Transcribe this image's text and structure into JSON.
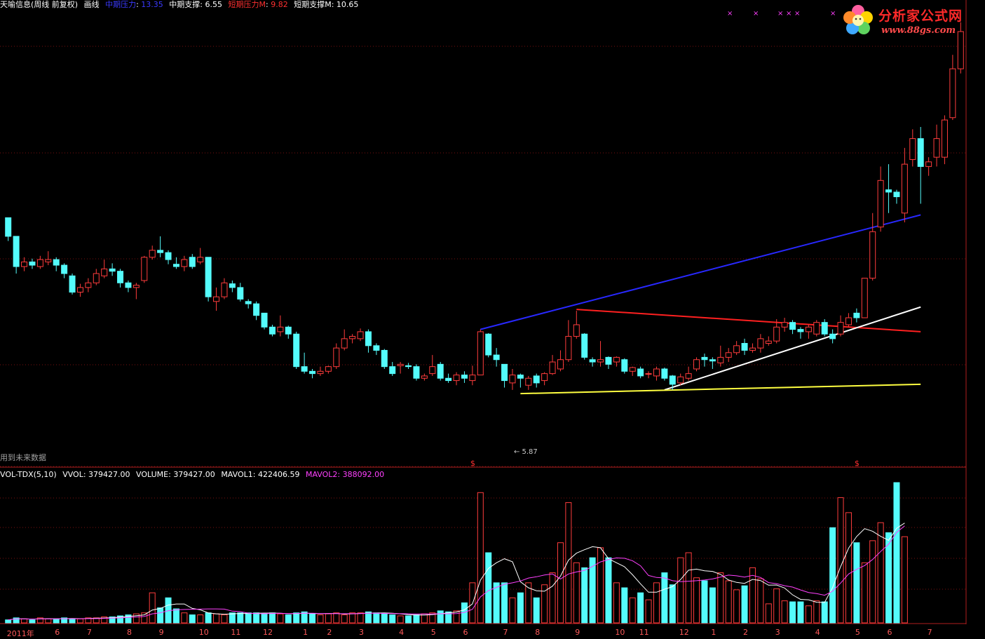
{
  "header": {
    "title": "天喻信息(周线 前复权)",
    "mode": "画线",
    "items": [
      {
        "label": "中期压力",
        "value": "13.35",
        "color": "#3a3aff"
      },
      {
        "label": "中期支撑",
        "value": "6.55",
        "color": "#ffffff"
      },
      {
        "label": "短期压力M",
        "value": "9.82",
        "color": "#ff3030"
      },
      {
        "label": "短期支撑M",
        "value": "10.65",
        "color": "#ffffff"
      }
    ]
  },
  "logo": {
    "title": "分析家公式网",
    "url": "www.88gs.com"
  },
  "future_note": "用到未来数据",
  "min_marker": "← 5.87",
  "signal_marker": "$",
  "volume_header": {
    "name": "VOL-TDX(5,10)",
    "items": [
      {
        "label": "VVOL",
        "value": "379427.00",
        "color": "#ffffff"
      },
      {
        "label": "VOLUME",
        "value": "379427.00",
        "color": "#ffffff"
      },
      {
        "label": "MAVOL1",
        "value": "422406.59",
        "color": "#ffffff"
      },
      {
        "label": "MAVOL2",
        "value": "388092.00",
        "color": "#ff40ff"
      }
    ]
  },
  "colors": {
    "up": "#ff3c3c",
    "down": "#54fcfc",
    "axis": "#b01e1e",
    "grid": "#7a1010"
  },
  "chart_data": {
    "type": "candlestick",
    "x_labels": [
      "2011年",
      "6",
      "7",
      "8",
      "9",
      "10",
      "11",
      "12",
      "1",
      "2",
      "3",
      "4",
      "5",
      "6",
      "7",
      "8",
      "9",
      "10",
      "11",
      "12",
      "1",
      "2",
      "3",
      "4",
      "5",
      "6",
      "7"
    ],
    "x_label_index": [
      0,
      6,
      10,
      15,
      19,
      24,
      28,
      32,
      37,
      40,
      44,
      49,
      53,
      57,
      62,
      66,
      71,
      76,
      79,
      84,
      88,
      92,
      96,
      101,
      106,
      110,
      115
    ],
    "price_range": [
      5.5,
      14.8
    ],
    "volume_range": [
      0,
      1400000
    ],
    "candles": [
      {
        "o": 10.8,
        "c": 10.4,
        "h": 10.8,
        "l": 10.3
      },
      {
        "o": 10.4,
        "c": 9.75,
        "h": 10.4,
        "l": 9.6
      },
      {
        "o": 9.75,
        "c": 9.85,
        "h": 9.95,
        "l": 9.65
      },
      {
        "o": 9.85,
        "c": 9.78,
        "h": 9.92,
        "l": 9.7
      },
      {
        "o": 9.75,
        "c": 9.9,
        "h": 9.98,
        "l": 9.7
      },
      {
        "o": 9.85,
        "c": 9.9,
        "h": 10.08,
        "l": 9.78
      },
      {
        "o": 9.9,
        "c": 9.78,
        "h": 9.95,
        "l": 9.65
      },
      {
        "o": 9.78,
        "c": 9.6,
        "h": 9.82,
        "l": 9.5
      },
      {
        "o": 9.55,
        "c": 9.2,
        "h": 9.6,
        "l": 9.15
      },
      {
        "o": 9.2,
        "c": 9.3,
        "h": 9.38,
        "l": 9.1
      },
      {
        "o": 9.3,
        "c": 9.4,
        "h": 9.5,
        "l": 9.2
      },
      {
        "o": 9.4,
        "c": 9.6,
        "h": 9.7,
        "l": 9.35
      },
      {
        "o": 9.55,
        "c": 9.7,
        "h": 9.9,
        "l": 9.5
      },
      {
        "o": 9.7,
        "c": 9.65,
        "h": 9.82,
        "l": 9.55
      },
      {
        "o": 9.65,
        "c": 9.4,
        "h": 9.7,
        "l": 9.3
      },
      {
        "o": 9.4,
        "c": 9.3,
        "h": 9.45,
        "l": 9.2
      },
      {
        "o": 9.3,
        "c": 9.35,
        "h": 9.4,
        "l": 9.05
      },
      {
        "o": 9.45,
        "c": 9.95,
        "h": 9.98,
        "l": 9.4
      },
      {
        "o": 9.95,
        "c": 10.1,
        "h": 10.2,
        "l": 9.9
      },
      {
        "o": 10.1,
        "c": 10.05,
        "h": 10.4,
        "l": 9.95
      },
      {
        "o": 10.05,
        "c": 9.9,
        "h": 10.1,
        "l": 9.8
      },
      {
        "o": 9.8,
        "c": 9.75,
        "h": 9.95,
        "l": 9.7
      },
      {
        "o": 9.75,
        "c": 9.9,
        "h": 9.98,
        "l": 9.65
      },
      {
        "o": 9.95,
        "c": 9.75,
        "h": 10.02,
        "l": 9.7
      },
      {
        "o": 9.85,
        "c": 9.95,
        "h": 10.15,
        "l": 9.8
      },
      {
        "o": 9.95,
        "c": 9.1,
        "h": 9.95,
        "l": 9.0
      },
      {
        "o": 9.0,
        "c": 9.1,
        "h": 9.3,
        "l": 8.8
      },
      {
        "o": 9.1,
        "c": 9.4,
        "h": 9.5,
        "l": 9.05
      },
      {
        "o": 9.38,
        "c": 9.3,
        "h": 9.45,
        "l": 9.2
      },
      {
        "o": 9.3,
        "c": 9.05,
        "h": 9.4,
        "l": 9.0
      },
      {
        "o": 9.0,
        "c": 8.95,
        "h": 9.05,
        "l": 8.85
      },
      {
        "o": 8.95,
        "c": 8.7,
        "h": 9.0,
        "l": 8.6
      },
      {
        "o": 8.75,
        "c": 8.45,
        "h": 8.75,
        "l": 8.4
      },
      {
        "o": 8.45,
        "c": 8.3,
        "h": 8.5,
        "l": 8.25
      },
      {
        "o": 8.35,
        "c": 8.45,
        "h": 8.7,
        "l": 8.25
      },
      {
        "o": 8.45,
        "c": 8.3,
        "h": 8.48,
        "l": 8.2
      },
      {
        "o": 8.3,
        "c": 7.6,
        "h": 8.35,
        "l": 7.55
      },
      {
        "o": 7.6,
        "c": 7.5,
        "h": 7.9,
        "l": 7.45
      },
      {
        "o": 7.5,
        "c": 7.45,
        "h": 7.55,
        "l": 7.35
      },
      {
        "o": 7.45,
        "c": 7.5,
        "h": 7.6,
        "l": 7.4
      },
      {
        "o": 7.5,
        "c": 7.6,
        "h": 7.62,
        "l": 7.45
      },
      {
        "o": 7.6,
        "c": 8.0,
        "h": 8.1,
        "l": 7.55
      },
      {
        "o": 8.0,
        "c": 8.2,
        "h": 8.4,
        "l": 7.95
      },
      {
        "o": 8.2,
        "c": 8.25,
        "h": 8.3,
        "l": 8.1
      },
      {
        "o": 8.2,
        "c": 8.35,
        "h": 8.42,
        "l": 8.15
      },
      {
        "o": 8.35,
        "c": 8.05,
        "h": 8.4,
        "l": 7.9
      },
      {
        "o": 8.05,
        "c": 7.95,
        "h": 8.1,
        "l": 7.85
      },
      {
        "o": 7.95,
        "c": 7.6,
        "h": 7.98,
        "l": 7.55
      },
      {
        "o": 7.6,
        "c": 7.45,
        "h": 7.7,
        "l": 7.4
      },
      {
        "o": 7.62,
        "c": 7.65,
        "h": 7.7,
        "l": 7.45
      },
      {
        "o": 7.62,
        "c": 7.6,
        "h": 7.68,
        "l": 7.55
      },
      {
        "o": 7.6,
        "c": 7.35,
        "h": 7.65,
        "l": 7.3
      },
      {
        "o": 7.35,
        "c": 7.4,
        "h": 7.45,
        "l": 7.3
      },
      {
        "o": 7.45,
        "c": 7.6,
        "h": 7.85,
        "l": 7.4
      },
      {
        "o": 7.65,
        "c": 7.35,
        "h": 7.7,
        "l": 7.3
      },
      {
        "o": 7.35,
        "c": 7.3,
        "h": 7.45,
        "l": 7.25
      },
      {
        "o": 7.3,
        "c": 7.42,
        "h": 7.48,
        "l": 7.2
      },
      {
        "o": 7.42,
        "c": 7.35,
        "h": 7.5,
        "l": 7.25
      },
      {
        "o": 7.3,
        "c": 7.42,
        "h": 7.62,
        "l": 7.2
      },
      {
        "o": 7.42,
        "c": 8.35,
        "h": 8.4,
        "l": 7.42
      },
      {
        "o": 8.3,
        "c": 7.85,
        "h": 8.32,
        "l": 7.8
      },
      {
        "o": 7.85,
        "c": 7.75,
        "h": 8.0,
        "l": 7.6
      },
      {
        "o": 7.65,
        "c": 7.3,
        "h": 7.65,
        "l": 7.15
      },
      {
        "o": 7.25,
        "c": 7.42,
        "h": 7.55,
        "l": 7.1
      },
      {
        "o": 7.42,
        "c": 7.35,
        "h": 7.45,
        "l": 7.15
      },
      {
        "o": 7.2,
        "c": 7.35,
        "h": 7.4,
        "l": 7.1
      },
      {
        "o": 7.4,
        "c": 7.25,
        "h": 7.45,
        "l": 7.15
      },
      {
        "o": 7.3,
        "c": 7.45,
        "h": 7.48,
        "l": 7.2
      },
      {
        "o": 7.45,
        "c": 7.7,
        "h": 7.85,
        "l": 7.42
      },
      {
        "o": 7.55,
        "c": 7.75,
        "h": 7.95,
        "l": 7.5
      },
      {
        "o": 7.75,
        "c": 8.25,
        "h": 8.6,
        "l": 7.7
      },
      {
        "o": 8.25,
        "c": 8.5,
        "h": 8.8,
        "l": 8.2
      },
      {
        "o": 8.3,
        "c": 7.8,
        "h": 8.32,
        "l": 7.75
      },
      {
        "o": 7.75,
        "c": 7.7,
        "h": 7.8,
        "l": 7.6
      },
      {
        "o": 7.7,
        "c": 7.75,
        "h": 8.15,
        "l": 7.6
      },
      {
        "o": 7.8,
        "c": 7.65,
        "h": 7.82,
        "l": 7.55
      },
      {
        "o": 7.7,
        "c": 7.8,
        "h": 7.82,
        "l": 7.6
      },
      {
        "o": 7.75,
        "c": 7.5,
        "h": 7.78,
        "l": 7.45
      },
      {
        "o": 7.5,
        "c": 7.58,
        "h": 7.6,
        "l": 7.4
      },
      {
        "o": 7.55,
        "c": 7.4,
        "h": 7.6,
        "l": 7.35
      },
      {
        "o": 7.45,
        "c": 7.45,
        "h": 7.5,
        "l": 7.35
      },
      {
        "o": 7.4,
        "c": 7.55,
        "h": 7.6,
        "l": 7.3
      },
      {
        "o": 7.55,
        "c": 7.35,
        "h": 7.58,
        "l": 7.3
      },
      {
        "o": 7.4,
        "c": 7.22,
        "h": 7.42,
        "l": 7.1
      },
      {
        "o": 7.25,
        "c": 7.38,
        "h": 7.45,
        "l": 7.2
      },
      {
        "o": 7.35,
        "c": 7.45,
        "h": 7.6,
        "l": 7.3
      },
      {
        "o": 7.55,
        "c": 7.75,
        "h": 7.8,
        "l": 7.5
      },
      {
        "o": 7.8,
        "c": 7.75,
        "h": 7.88,
        "l": 7.6
      },
      {
        "o": 7.75,
        "c": 7.72,
        "h": 7.8,
        "l": 7.55
      },
      {
        "o": 7.68,
        "c": 7.8,
        "h": 8.05,
        "l": 7.6
      },
      {
        "o": 7.8,
        "c": 7.9,
        "h": 8.0,
        "l": 7.7
      },
      {
        "o": 7.9,
        "c": 8.05,
        "h": 8.15,
        "l": 7.85
      },
      {
        "o": 8.1,
        "c": 7.95,
        "h": 8.2,
        "l": 7.85
      },
      {
        "o": 7.95,
        "c": 8.0,
        "h": 8.1,
        "l": 7.9
      },
      {
        "o": 8.0,
        "c": 8.2,
        "h": 8.3,
        "l": 7.9
      },
      {
        "o": 8.1,
        "c": 8.15,
        "h": 8.25,
        "l": 8.05
      },
      {
        "o": 8.15,
        "c": 8.45,
        "h": 8.62,
        "l": 8.1
      },
      {
        "o": 8.45,
        "c": 8.55,
        "h": 8.65,
        "l": 8.35
      },
      {
        "o": 8.55,
        "c": 8.4,
        "h": 8.6,
        "l": 8.3
      },
      {
        "o": 8.4,
        "c": 8.35,
        "h": 8.45,
        "l": 8.2
      },
      {
        "o": 8.35,
        "c": 8.45,
        "h": 8.5,
        "l": 8.2
      },
      {
        "o": 8.3,
        "c": 8.55,
        "h": 8.6,
        "l": 8.25
      },
      {
        "o": 8.55,
        "c": 8.3,
        "h": 8.62,
        "l": 8.25
      },
      {
        "o": 8.3,
        "c": 8.2,
        "h": 8.4,
        "l": 8.1
      },
      {
        "o": 8.3,
        "c": 8.55,
        "h": 8.7,
        "l": 8.25
      },
      {
        "o": 8.5,
        "c": 8.65,
        "h": 8.75,
        "l": 8.45
      },
      {
        "o": 8.75,
        "c": 8.65,
        "h": 8.85,
        "l": 8.55
      },
      {
        "o": 8.65,
        "c": 9.5,
        "h": 9.5,
        "l": 8.65
      },
      {
        "o": 9.5,
        "c": 10.5,
        "h": 10.9,
        "l": 9.45
      },
      {
        "o": 10.6,
        "c": 11.6,
        "h": 11.9,
        "l": 10.5
      },
      {
        "o": 11.4,
        "c": 11.35,
        "h": 11.95,
        "l": 10.9
      },
      {
        "o": 11.35,
        "c": 11.25,
        "h": 11.4,
        "l": 11.1
      },
      {
        "o": 10.9,
        "c": 11.95,
        "h": 12.3,
        "l": 10.7
      },
      {
        "o": 12.05,
        "c": 12.5,
        "h": 12.7,
        "l": 11.9
      },
      {
        "o": 12.5,
        "c": 11.9,
        "h": 12.75,
        "l": 11.1
      },
      {
        "o": 11.9,
        "c": 12.0,
        "h": 12.1,
        "l": 11.7
      },
      {
        "o": 12.1,
        "c": 12.5,
        "h": 12.8,
        "l": 11.9
      },
      {
        "o": 12.1,
        "c": 12.9,
        "h": 13.0,
        "l": 11.95
      },
      {
        "o": 12.95,
        "c": 14.0,
        "h": 14.3,
        "l": 12.9
      },
      {
        "o": 14.0,
        "c": 14.8,
        "h": 15.0,
        "l": 13.9
      }
    ],
    "volume": [
      30000,
      50000,
      40000,
      30000,
      50000,
      40000,
      40000,
      50000,
      40000,
      40000,
      50000,
      50000,
      60000,
      60000,
      70000,
      80000,
      90000,
      100000,
      300000,
      150000,
      250000,
      140000,
      100000,
      80000,
      80000,
      100000,
      90000,
      80000,
      100000,
      100000,
      100000,
      100000,
      90000,
      100000,
      90000,
      80000,
      100000,
      110000,
      90000,
      80000,
      90000,
      100000,
      80000,
      100000,
      100000,
      110000,
      100000,
      90000,
      80000,
      70000,
      70000,
      80000,
      90000,
      100000,
      120000,
      110000,
      120000,
      200000,
      400000,
      1300000,
      700000,
      400000,
      400000,
      250000,
      300000,
      400000,
      250000,
      380000,
      500000,
      800000,
      1200000,
      600000,
      550000,
      650000,
      750000,
      650000,
      400000,
      350000,
      250000,
      300000,
      230000,
      400000,
      500000,
      380000,
      650000,
      700000,
      450000,
      420000,
      350000,
      500000,
      420000,
      330000,
      370000,
      550000,
      440000,
      190000,
      340000,
      220000,
      210000,
      210000,
      170000,
      220000,
      210000,
      950000,
      1250000,
      1100000,
      800000,
      600000,
      820000,
      1000000,
      900000,
      1400000,
      860000
    ]
  },
  "overlays": [
    {
      "name": "mid-pressure-line",
      "color": "#2828ff",
      "from": [
        59,
        8.4
      ],
      "to": [
        114,
        10.86
      ]
    },
    {
      "name": "short-pressure-line",
      "color": "#ff2020",
      "from": [
        71,
        8.83
      ],
      "to": [
        114,
        8.35
      ]
    },
    {
      "name": "short-support-line",
      "color": "#ffffff",
      "from": [
        82,
        7.1
      ],
      "to": [
        114,
        8.88
      ]
    },
    {
      "name": "mid-support-line",
      "color": "#ffff40",
      "from": [
        64,
        7.02
      ],
      "to": [
        114,
        7.22
      ]
    }
  ]
}
